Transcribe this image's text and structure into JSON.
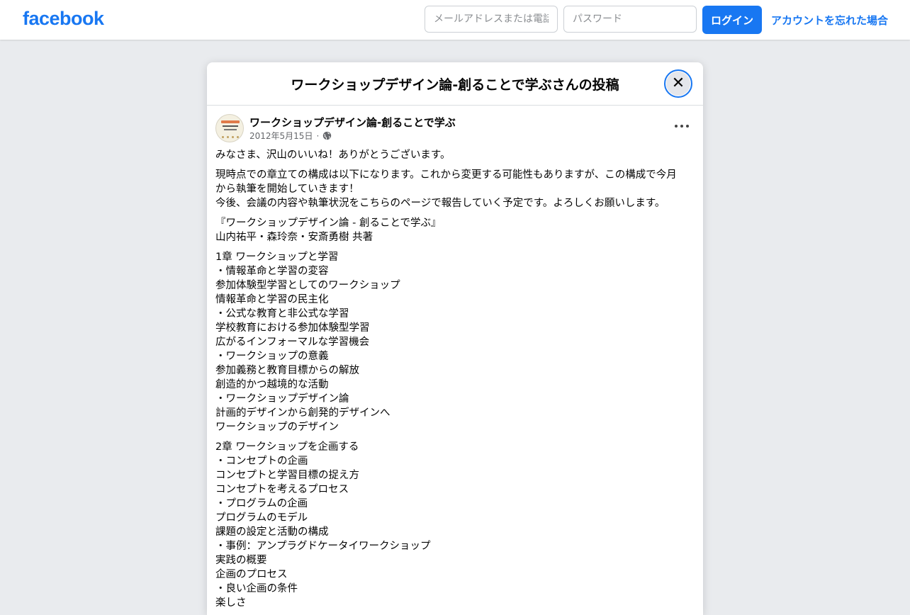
{
  "topbar": {
    "logo": "facebook",
    "email_placeholder": "メールアドレスまたは電話番号",
    "password_placeholder": "パスワード",
    "login_label": "ログイン",
    "forgot_label": "アカウントを忘れた場合"
  },
  "modal": {
    "title": "ワークショップデザイン論-創ることで学ぶさんの投稿",
    "close_glyph": "✕"
  },
  "post": {
    "page_name": "ワークショップデザイン論-創ることで学ぶ",
    "date": "2012年5月15日",
    "paragraphs": [
      [
        "みなさま、沢山のいいね！ありがとうございます。"
      ],
      [
        "現時点での章立ての構成は以下になります。これから変更する可能性もありますが、この構成で今月",
        "から執筆を開始していきます！",
        "今後、会議の内容や執筆状況をこちらのページで報告していく予定です。よろしくお願いします。"
      ],
      [
        "『ワークショップデザイン論 - 創ることで学ぶ』",
        "山内祐平・森玲奈・安斎勇樹 共著"
      ],
      [
        "1章 ワークショップと学習",
        "・情報革命と学習の変容",
        "参加体験型学習としてのワークショップ",
        "情報革命と学習の民主化",
        "・公式な教育と非公式な学習",
        "学校教育における参加体験型学習",
        "広がるインフォーマルな学習機会",
        "・ワークショップの意義",
        "参加義務と教育目標からの解放",
        "創造的かつ越境的な活動",
        "・ワークショップデザイン論",
        "計画的デザインから創発的デザインへ",
        "ワークショップのデザイン"
      ],
      [
        "2章 ワークショップを企画する",
        "・コンセプトの企画",
        "コンセプトと学習目標の捉え方",
        "コンセプトを考えるプロセス",
        "・プログラムの企画",
        "プログラムのモデル",
        "課題の設定と活動の構成",
        "・事例：アンプラグドケータイワークショップ",
        "実践の概要",
        "企画のプロセス",
        "・良い企画の条件",
        "楽しさ"
      ]
    ]
  }
}
